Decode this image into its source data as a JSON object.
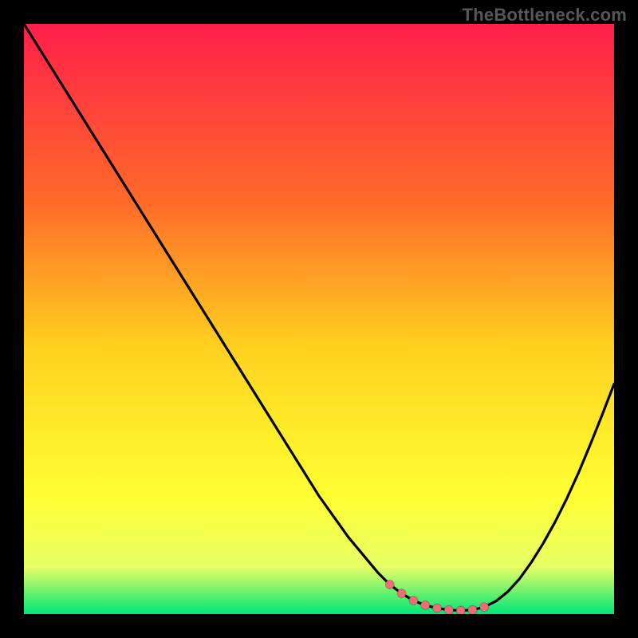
{
  "watermark": "TheBottleneck.com",
  "colors": {
    "gradient_top": "#ff1f4b",
    "gradient_mid1": "#ff6a2a",
    "gradient_mid2": "#ffd21f",
    "gradient_mid3": "#ffff33",
    "gradient_mid4": "#e8ff66",
    "gradient_bottom": "#00e676",
    "curve": "#000000",
    "marker": "#ee6e73",
    "background": "#000000"
  },
  "chart_data": {
    "type": "line",
    "title": "",
    "xlabel": "",
    "ylabel": "",
    "xlim": [
      0,
      100
    ],
    "ylim": [
      0,
      100
    ],
    "grid": false,
    "legend": false,
    "x": [
      0,
      5,
      10,
      15,
      20,
      25,
      30,
      35,
      40,
      45,
      50,
      55,
      60,
      62,
      64,
      66,
      68,
      70,
      72,
      74,
      76,
      78,
      80,
      82,
      84,
      86,
      88,
      90,
      92,
      94,
      96,
      98,
      100
    ],
    "values": [
      100,
      92,
      84,
      76,
      68,
      60,
      52,
      44,
      36,
      28,
      20,
      13,
      7,
      5,
      3.5,
      2.3,
      1.5,
      1.0,
      0.7,
      0.6,
      0.7,
      1.2,
      2.2,
      3.8,
      6.0,
      8.8,
      12.0,
      15.6,
      19.6,
      24.0,
      28.8,
      33.8,
      39.0
    ],
    "markers_x": [
      62,
      64,
      66,
      68,
      70,
      72,
      74,
      76,
      78
    ],
    "markers_y": [
      5.0,
      3.5,
      2.3,
      1.5,
      1.0,
      0.7,
      0.6,
      0.7,
      1.2
    ],
    "annotations": []
  }
}
